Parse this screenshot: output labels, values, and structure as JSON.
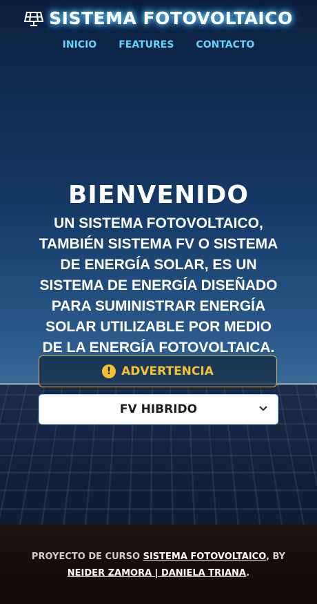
{
  "header": {
    "title": "SISTEMA FOTOVOLTAICO",
    "nav": [
      "INICIO",
      "FEATURES",
      "CONTACTO"
    ]
  },
  "hero": {
    "title": "BIENVENIDO",
    "text": "UN SISTEMA FOTOVOLTAICO, TAMBIÉN SISTEMA FV O SISTEMA DE ENERGÍA SOLAR, ES UN SISTEMA DE ENERGÍA DISEÑADO PARA SUMINISTRAR ENERGÍA SOLAR UTILIZABLE POR MEDIO DE LA ENERGÍA FOTOVOLTAICA."
  },
  "alert": {
    "icon": "exclamation-icon",
    "label": "ADVERTENCIA"
  },
  "select": {
    "value": "FV HIBRIDO"
  },
  "footer": {
    "prefix": "PROYECTO DE CURSO ",
    "project_link": "SISTEMA FOTOVOLTAICO",
    "by": ", BY ",
    "authors_link": "NEIDER ZAMORA | DANIELA TRIANA",
    "suffix": "."
  },
  "colors": {
    "accent": "#5fd6ff",
    "warning": "#f2c230"
  }
}
